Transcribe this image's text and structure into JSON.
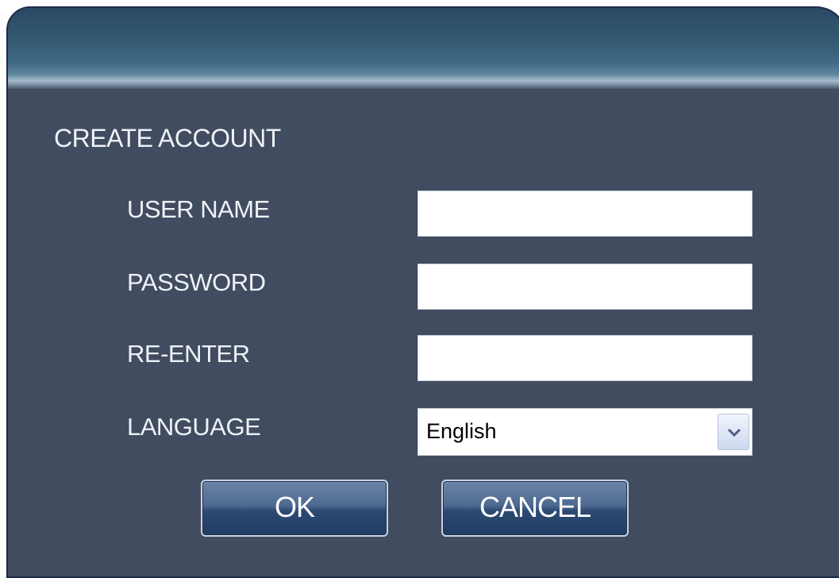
{
  "dialog": {
    "section_title": "CREATE ACCOUNT",
    "fields": {
      "username": {
        "label": "USER NAME",
        "value": ""
      },
      "password": {
        "label": "PASSWORD",
        "value": ""
      },
      "reenter": {
        "label": "RE-ENTER",
        "value": ""
      },
      "language": {
        "label": "LANGUAGE",
        "selected": "English"
      }
    },
    "buttons": {
      "ok": "OK",
      "cancel": "CANCEL"
    }
  },
  "colors": {
    "dialog_background": "#414c60",
    "titlebar": "#33566f",
    "button": "#2d4a73",
    "text": "#eef1f6"
  },
  "icons": {
    "language_dropdown": "chevron-down-icon"
  }
}
